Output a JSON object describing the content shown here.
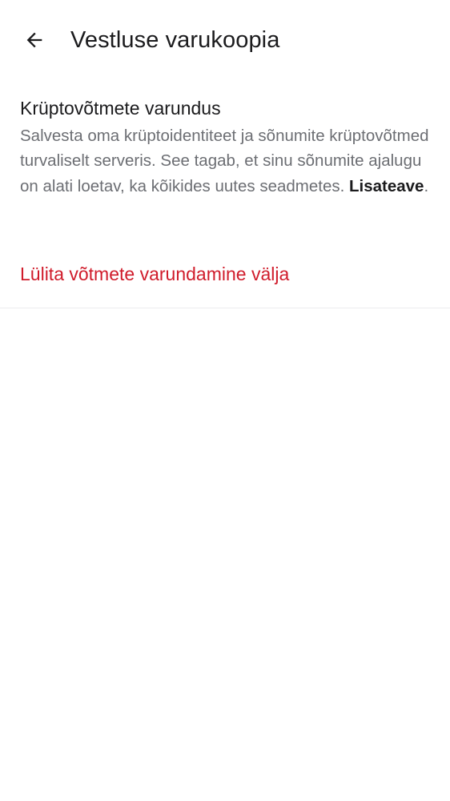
{
  "header": {
    "back_icon": "arrow-left-icon",
    "title": "Vestluse varukoopia"
  },
  "key_backup": {
    "title": "Krüptovõtmete varundus",
    "description": "Salvesta oma krüptoidentiteet ja sõnumite krüptovõtmed turvaliselt serveris. See tagab, et sinu sõnumite ajalugu on alati loetav, ka kõikides uutes seadmetes.",
    "learn_more_label": "Lisateave",
    "learn_more_suffix": "."
  },
  "actions": {
    "disable_label": "Lülita võtmete varundamine välja",
    "disable_color": "#d01c2b"
  },
  "colors": {
    "text_primary": "#1b1b1d",
    "text_secondary": "#6c6e73",
    "divider": "#ececee",
    "background": "#ffffff"
  }
}
